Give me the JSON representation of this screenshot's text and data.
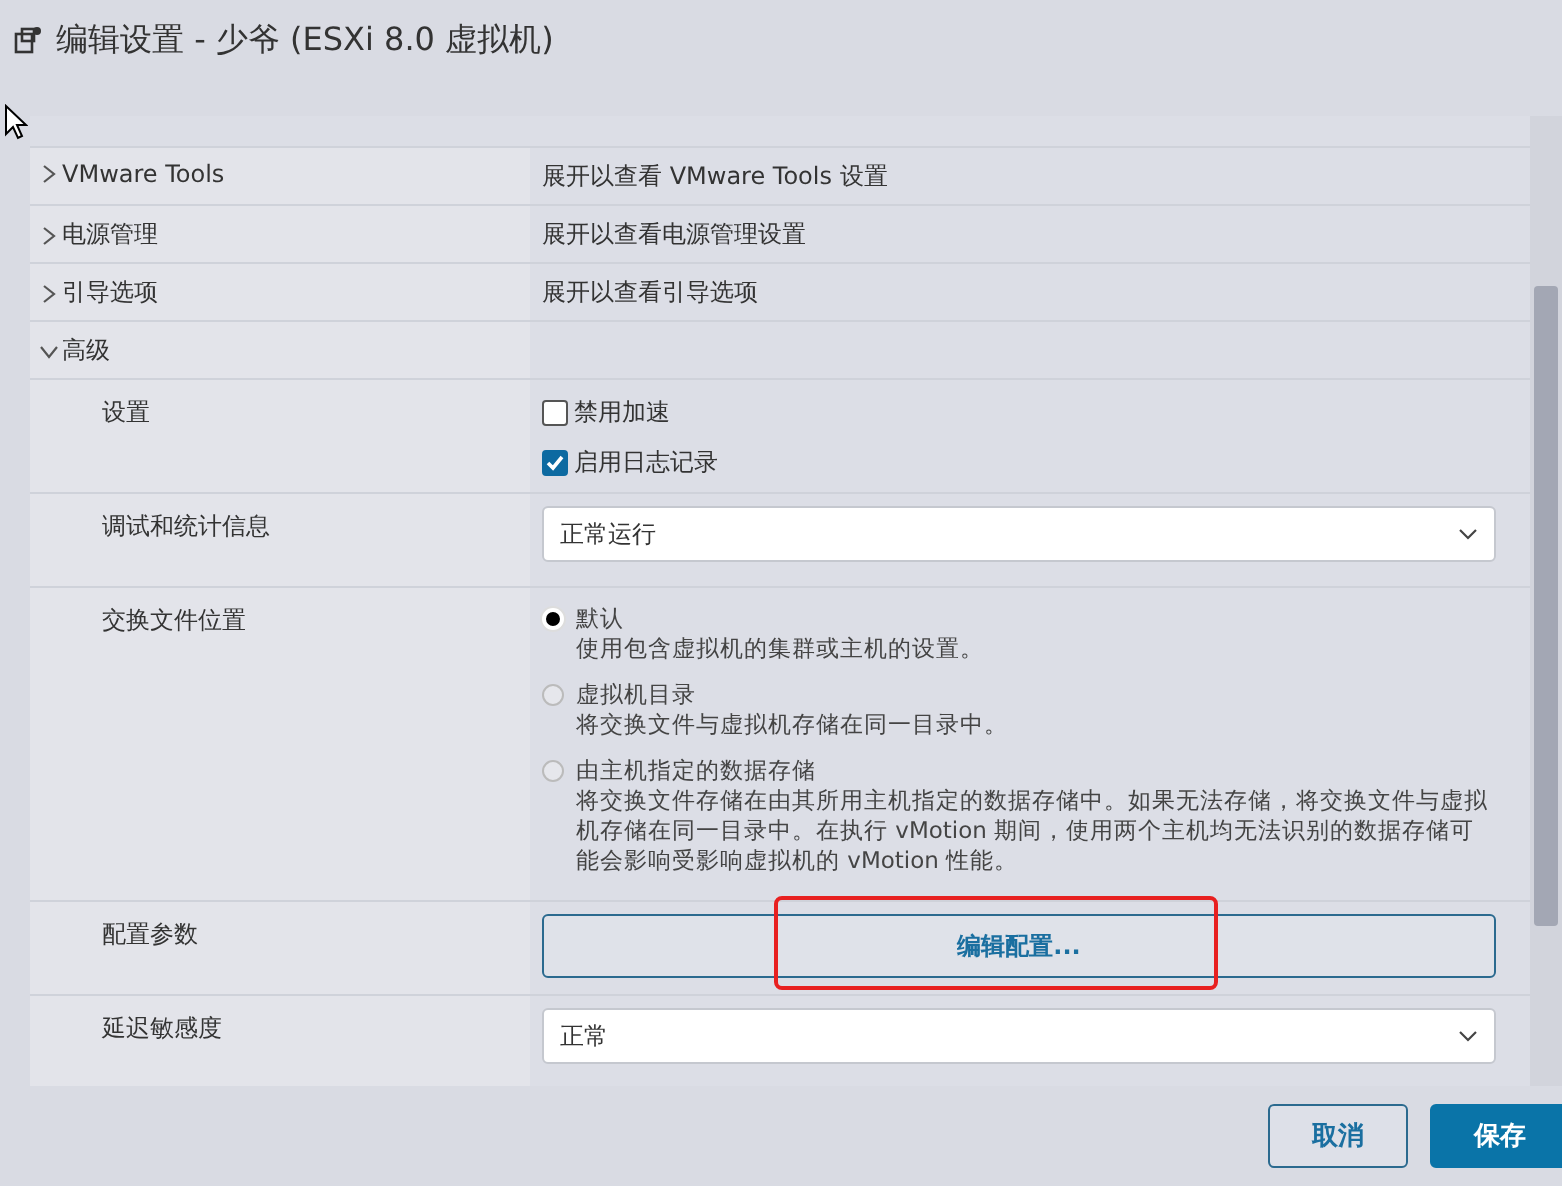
{
  "window": {
    "title": "编辑设置 - 少爷 (ESXi 8.0 虚拟机)"
  },
  "sections": [
    {
      "label": "VMware Tools",
      "summary": "展开以查看 VMware Tools 设置",
      "expanded": false
    },
    {
      "label": "电源管理",
      "summary": "展开以查看电源管理设置",
      "expanded": false
    },
    {
      "label": "引导选项",
      "summary": "展开以查看引导选项",
      "expanded": false
    },
    {
      "label": "高级",
      "expanded": true
    }
  ],
  "advanced_rows": [
    {
      "kind": "checkboxes",
      "label": "设置",
      "options": [
        {
          "label": "禁用加速",
          "checked": false
        },
        {
          "label": "启用日志记录",
          "checked": true
        }
      ]
    },
    {
      "kind": "select",
      "label": "调试和统计信息",
      "value": "正常运行"
    },
    {
      "kind": "radios",
      "label": "交换文件位置",
      "options": [
        {
          "label": "默认",
          "description": "使用包含虚拟机的集群或主机的设置。",
          "selected": true
        },
        {
          "label": "虚拟机目录",
          "description": "将交换文件与虚拟机存储在同一目录中。",
          "selected": false
        },
        {
          "label": "由主机指定的数据存储",
          "description": "将交换文件存储在由其所用主机指定的数据存储中。如果无法存储，将交换文件与虚拟机存储在同一目录中。在执行 vMotion 期间，使用两个主机均无法识别的数据存储可能会影响受影响虚拟机的 vMotion 性能。",
          "selected": false
        }
      ]
    },
    {
      "kind": "button",
      "label": "配置参数",
      "value": "编辑配置...",
      "highlighted": true
    },
    {
      "kind": "select",
      "label": "延迟敏感度",
      "value": "正常"
    }
  ],
  "buttons": [
    {
      "label": "取消",
      "kind": "secondary"
    },
    {
      "label": "保存",
      "kind": "primary"
    }
  ]
}
